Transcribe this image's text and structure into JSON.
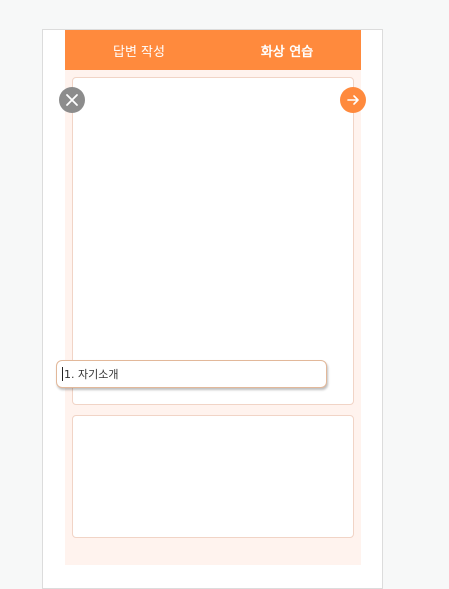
{
  "tabs": [
    {
      "label": "답변 작성",
      "active": false
    },
    {
      "label": "화상 연습",
      "active": true
    }
  ],
  "controls": {
    "close_icon": "close-icon",
    "next_icon": "arrow-right-icon"
  },
  "question_select": {
    "value": "1. 자기소개"
  },
  "colors": {
    "accent": "#ff8a3d",
    "panel_bg": "#fff3ee",
    "close_bg": "#8c8c8c"
  }
}
